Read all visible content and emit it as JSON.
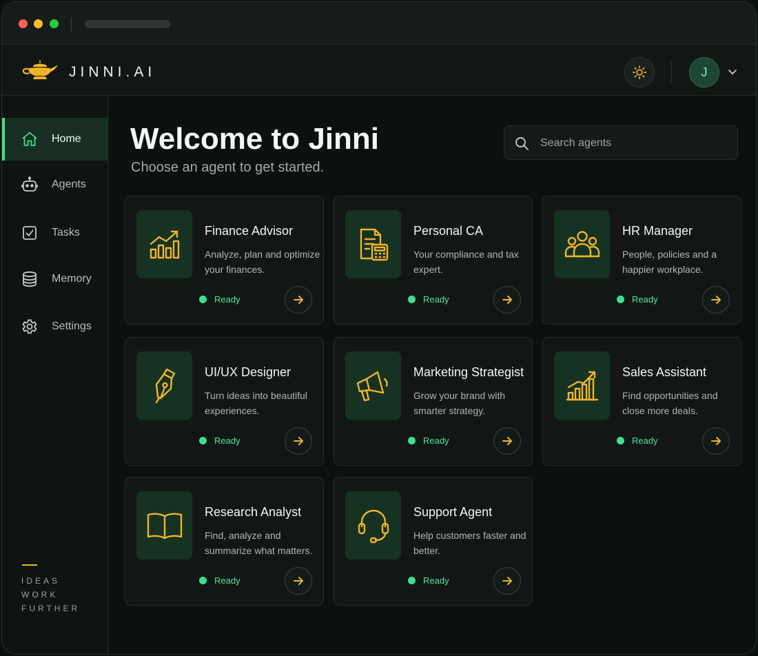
{
  "brand": {
    "name": "JINNI.AI"
  },
  "header": {
    "avatar_initial": "J"
  },
  "sidebar": {
    "items": [
      {
        "label": "Home",
        "icon": "home-icon",
        "active": true
      },
      {
        "label": "Agents",
        "icon": "robot-icon",
        "active": false
      },
      {
        "label": "Tasks",
        "icon": "checkbox-icon",
        "active": false
      },
      {
        "label": "Memory",
        "icon": "database-icon",
        "active": false
      },
      {
        "label": "Settings",
        "icon": "gear-icon",
        "active": false
      }
    ],
    "tagline": [
      "IDEAS",
      "WORK",
      "FURTHER"
    ]
  },
  "main": {
    "title": "Welcome to Jinni",
    "subtitle": "Choose an agent to get started.",
    "search": {
      "placeholder": "Search agents"
    }
  },
  "agents": [
    {
      "title": "Finance Advisor",
      "desc": "Analyze, plan and optimize your finances.",
      "status": "Ready",
      "icon": "bar-chart-icon"
    },
    {
      "title": "Personal CA",
      "desc": "Your compliance and tax expert.",
      "status": "Ready",
      "icon": "calculator-document-icon"
    },
    {
      "title": "HR Manager",
      "desc": "People, policies and a happier workplace.",
      "status": "Ready",
      "icon": "people-icon"
    },
    {
      "title": "UI/UX Designer",
      "desc": "Turn ideas into beautiful experiences.",
      "status": "Ready",
      "icon": "pen-nib-icon"
    },
    {
      "title": "Marketing Strategist",
      "desc": "Grow your brand with smarter strategy.",
      "status": "Ready",
      "icon": "megaphone-icon"
    },
    {
      "title": "Sales Assistant",
      "desc": "Find opportunities and close more deals.",
      "status": "Ready",
      "icon": "growth-chart-icon"
    },
    {
      "title": "Research Analyst",
      "desc": "Find, analyze and summarize what matters.",
      "status": "Ready",
      "icon": "book-icon"
    },
    {
      "title": "Support Agent",
      "desc": "Help customers faster and better.",
      "status": "Ready",
      "icon": "headset-icon"
    }
  ],
  "colors": {
    "accent": "#3ee08e",
    "gold": "#f0b429",
    "background": "#0c100e"
  }
}
